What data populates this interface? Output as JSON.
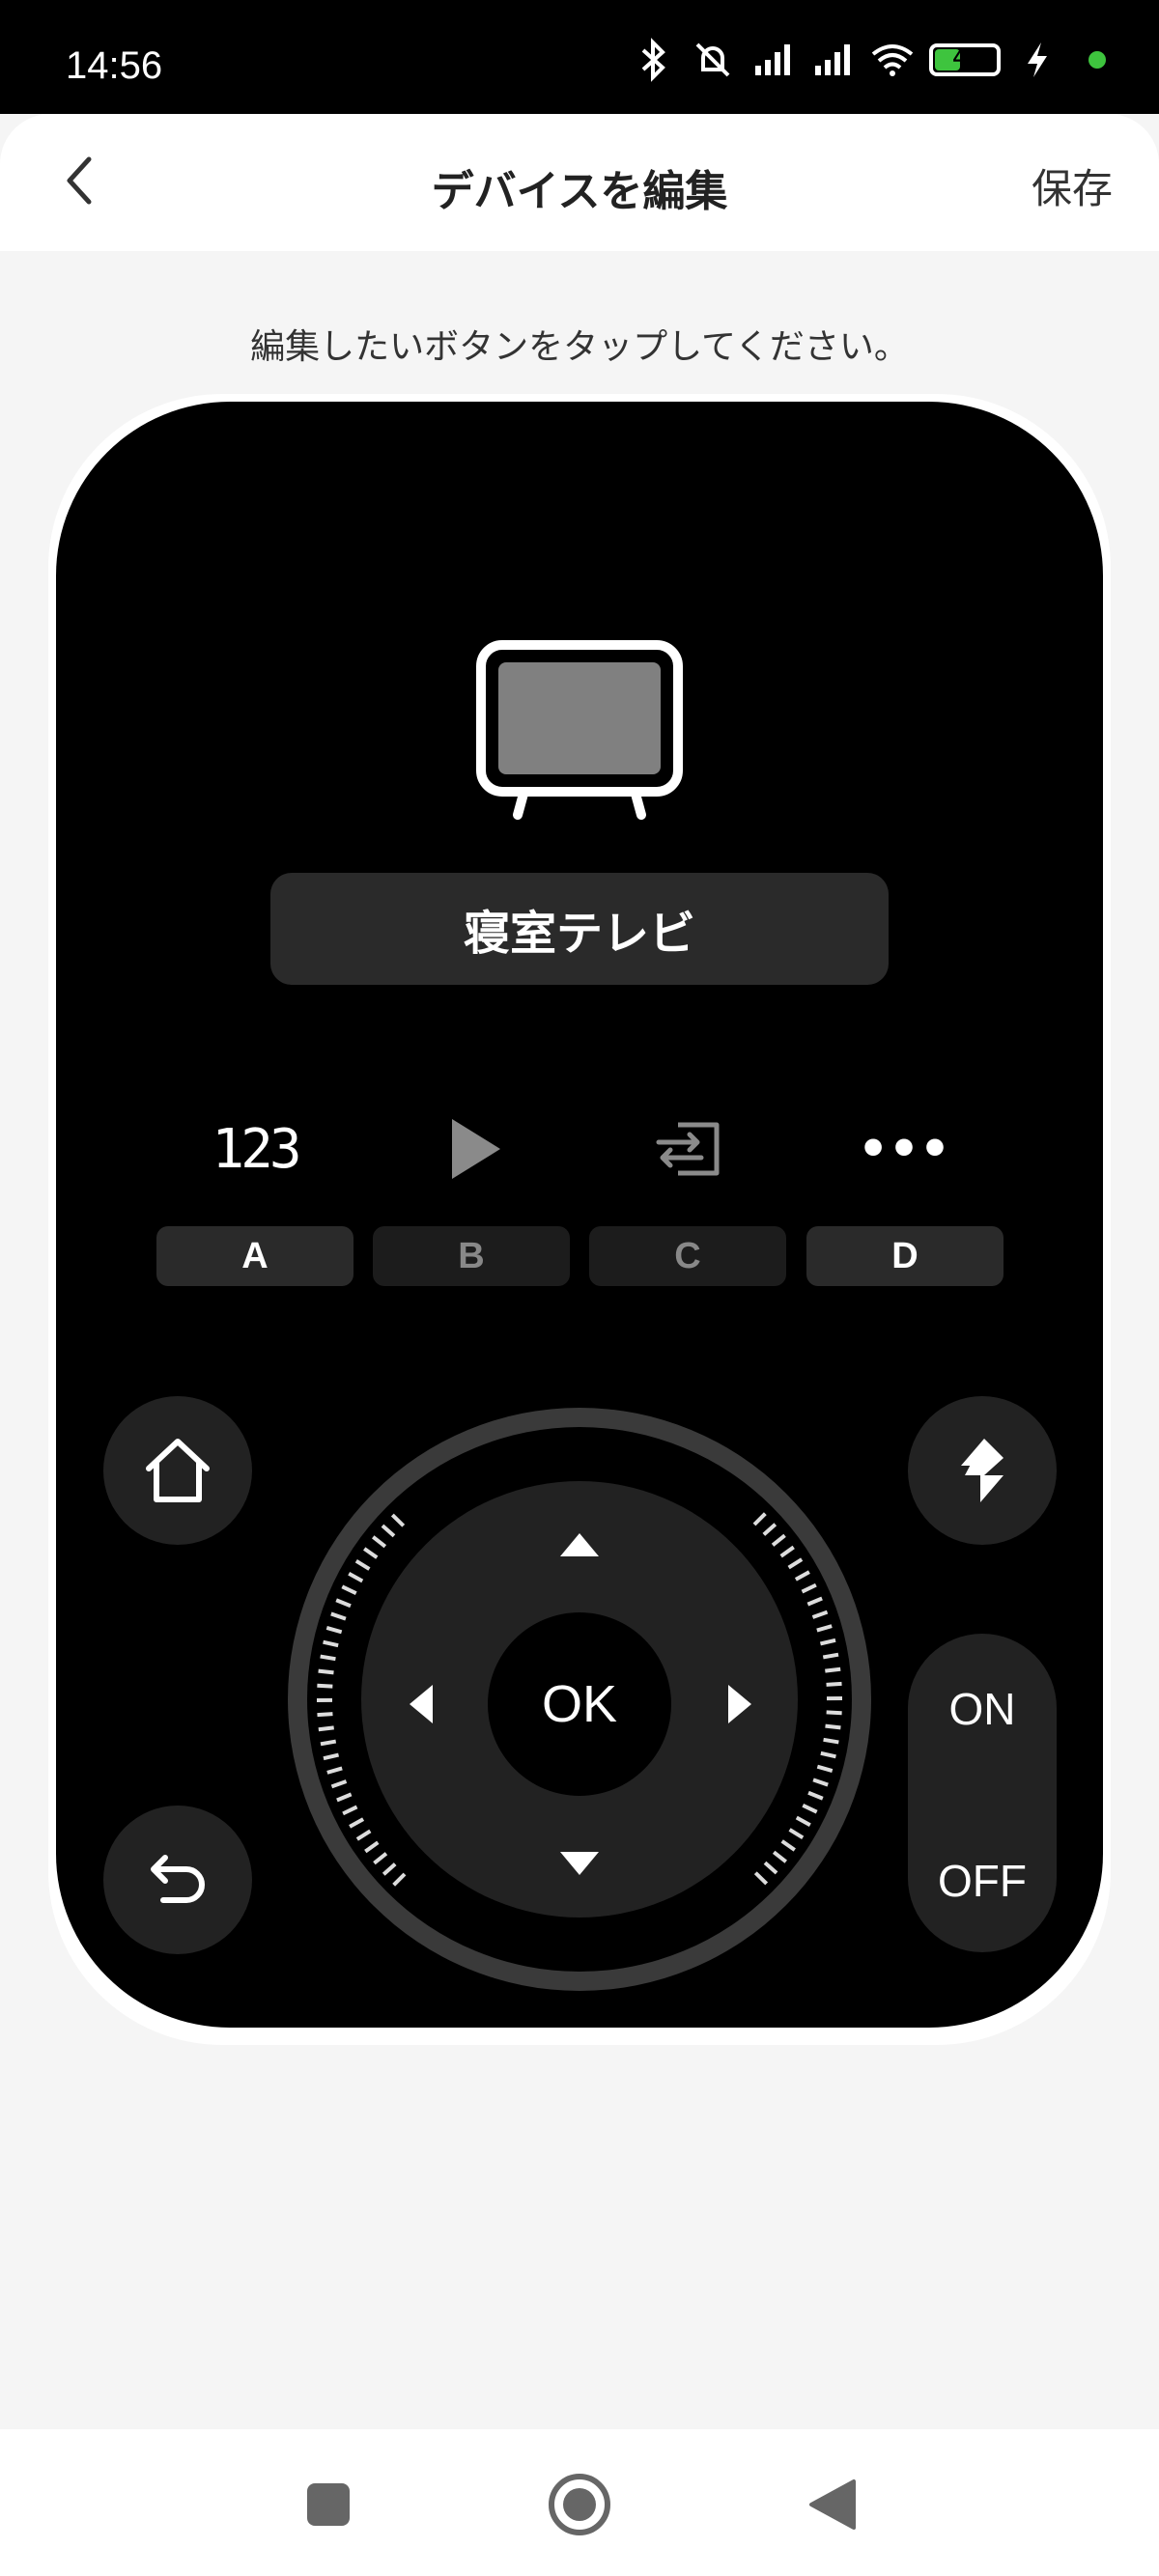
{
  "status_bar": {
    "time": "14:56",
    "battery": "42",
    "icons": [
      "bluetooth-icon",
      "muted-bell-icon",
      "signal-icon",
      "signal-icon",
      "wifi-icon",
      "battery-icon",
      "charging-icon",
      "dot-icon"
    ]
  },
  "header": {
    "title": "デバイスを編集",
    "save_label": "保存"
  },
  "instruction": "編集したいボタンをタップしてください。",
  "remote": {
    "device_name": "寝室テレビ",
    "function_buttons": {
      "numbers": "123",
      "more": "•••"
    },
    "ab_buttons": [
      "A",
      "B",
      "C",
      "D"
    ],
    "ok_label": "OK",
    "on_label": "ON",
    "off_label": "OFF"
  },
  "colors": {
    "background": "#f5f5f5",
    "remote": "#000000",
    "button": "#222222",
    "battery_green": "#3ec43e"
  }
}
